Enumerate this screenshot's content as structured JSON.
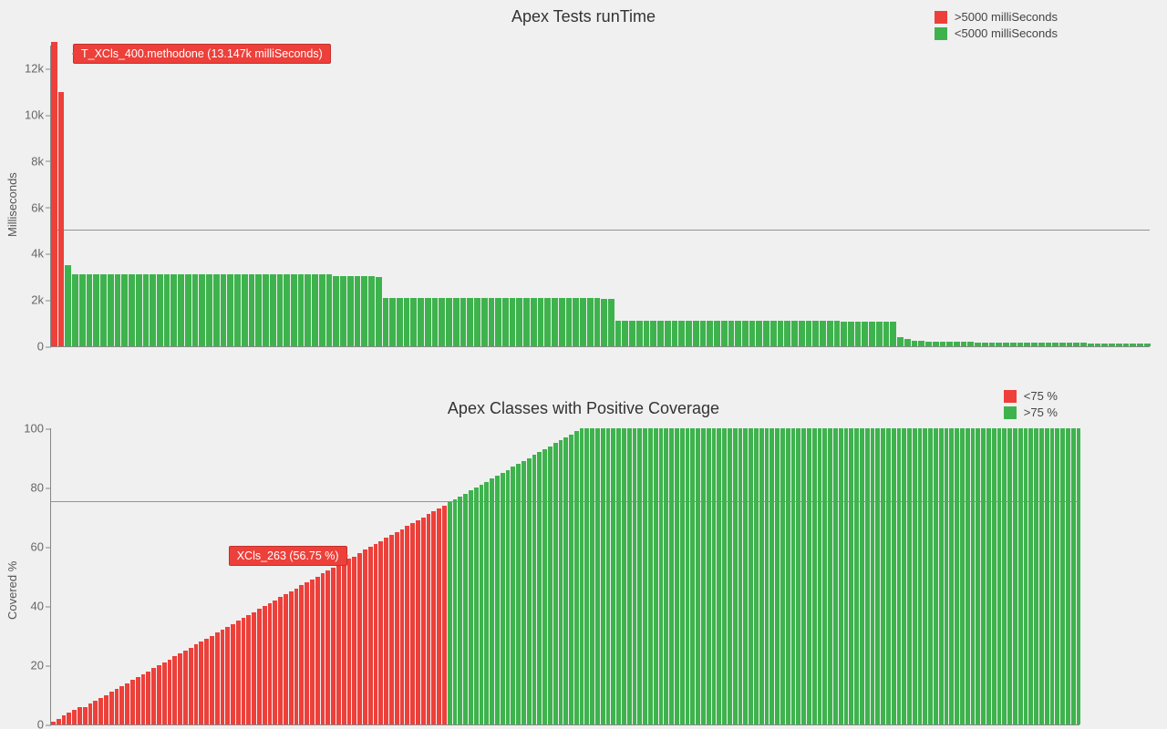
{
  "charts": {
    "runtime": {
      "title": "Apex Tests runTime",
      "ylabel": "Milliseconds",
      "legend_over": ">5000 milliSeconds",
      "legend_under": "<5000 milliSeconds",
      "callout": "T_XCls_400.methodone (13.147k milliSeconds)"
    },
    "coverage": {
      "title": "Apex Classes with Positive Coverage",
      "ylabel": "Covered %",
      "legend_under": "<75 %",
      "legend_over": ">75 %",
      "callout": "XCls_263 (56.75 %)"
    }
  },
  "chart_data": [
    {
      "type": "bar",
      "title": "Apex Tests runTime",
      "ylabel": "Milliseconds",
      "ylim": [
        0,
        13000
      ],
      "yticks": [
        0,
        2000,
        4000,
        6000,
        8000,
        10000,
        12000
      ],
      "ytick_labels": [
        "0",
        "2k",
        "4k",
        "6k",
        "8k",
        "10k",
        "12k"
      ],
      "threshold": 5000,
      "legend": [
        {
          "name": ">5000 milliSeconds",
          "color": "#ED403A"
        },
        {
          "name": "<5000 milliSeconds",
          "color": "#3EB34D"
        }
      ],
      "annotation": {
        "label": "T_XCls_400.methodone",
        "value": 13147,
        "value_display": "13.147k milliSeconds"
      },
      "values": [
        13147,
        11000,
        3500,
        3100,
        3100,
        3100,
        3100,
        3100,
        3100,
        3100,
        3100,
        3100,
        3100,
        3100,
        3100,
        3100,
        3100,
        3100,
        3100,
        3100,
        3100,
        3100,
        3100,
        3100,
        3100,
        3100,
        3100,
        3100,
        3100,
        3100,
        3100,
        3100,
        3100,
        3100,
        3100,
        3100,
        3100,
        3100,
        3100,
        3100,
        3050,
        3050,
        3050,
        3050,
        3050,
        3050,
        3000,
        2100,
        2100,
        2100,
        2100,
        2100,
        2100,
        2100,
        2100,
        2100,
        2100,
        2100,
        2100,
        2100,
        2100,
        2100,
        2100,
        2100,
        2100,
        2100,
        2100,
        2100,
        2100,
        2100,
        2100,
        2100,
        2100,
        2100,
        2100,
        2100,
        2100,
        2100,
        2050,
        2050,
        1100,
        1100,
        1100,
        1100,
        1100,
        1100,
        1100,
        1100,
        1100,
        1100,
        1100,
        1100,
        1100,
        1100,
        1100,
        1100,
        1100,
        1100,
        1100,
        1100,
        1100,
        1100,
        1100,
        1100,
        1100,
        1100,
        1100,
        1100,
        1100,
        1100,
        1100,
        1100,
        1050,
        1050,
        1050,
        1050,
        1050,
        1050,
        1050,
        1050,
        400,
        300,
        250,
        250,
        200,
        200,
        200,
        200,
        180,
        180,
        180,
        170,
        170,
        160,
        160,
        160,
        150,
        150,
        150,
        150,
        150,
        150,
        140,
        140,
        140,
        140,
        140,
        130,
        130,
        130,
        130,
        130,
        120,
        120,
        120,
        120
      ]
    },
    {
      "type": "bar",
      "title": "Apex Classes with Positive Coverage",
      "ylabel": "Covered %",
      "ylim": [
        0,
        100
      ],
      "yticks": [
        0,
        20,
        40,
        60,
        80,
        100
      ],
      "ytick_labels": [
        "0",
        "20",
        "40",
        "60",
        "80",
        "100"
      ],
      "threshold": 75,
      "legend": [
        {
          "name": "<75 %",
          "color": "#ED403A"
        },
        {
          "name": ">75 %",
          "color": "#3EB34D"
        }
      ],
      "annotation": {
        "label": "XCls_263",
        "value": 56.75,
        "value_display": "56.75 %"
      },
      "values": [
        1,
        2,
        3,
        4,
        5,
        6,
        6,
        7,
        8,
        9,
        10,
        11,
        12,
        13,
        14,
        15,
        16,
        17,
        18,
        19,
        20,
        21,
        22,
        23,
        24,
        25,
        26,
        27,
        28,
        29,
        30,
        31,
        32,
        33,
        34,
        35,
        36,
        37,
        38,
        39,
        40,
        41,
        42,
        43,
        44,
        45,
        46,
        47,
        48,
        49,
        50,
        51,
        52,
        53,
        54,
        55,
        56,
        56.75,
        58,
        59,
        60,
        61,
        62,
        63,
        64,
        65,
        66,
        67,
        68,
        69,
        70,
        71,
        72,
        73,
        74,
        75,
        76,
        77,
        78,
        79,
        80,
        81,
        82,
        83,
        84,
        85,
        86,
        87,
        88,
        89,
        90,
        91,
        92,
        93,
        94,
        95,
        96,
        97,
        98,
        99,
        100,
        100,
        100,
        100,
        100,
        100,
        100,
        100,
        100,
        100,
        100,
        100,
        100,
        100,
        100,
        100,
        100,
        100,
        100,
        100,
        100,
        100,
        100,
        100,
        100,
        100,
        100,
        100,
        100,
        100,
        100,
        100,
        100,
        100,
        100,
        100,
        100,
        100,
        100,
        100,
        100,
        100,
        100,
        100,
        100,
        100,
        100,
        100,
        100,
        100,
        100,
        100,
        100,
        100,
        100,
        100,
        100,
        100,
        100,
        100,
        100,
        100,
        100,
        100,
        100,
        100,
        100,
        100,
        100,
        100,
        100,
        100,
        100,
        100,
        100,
        100,
        100,
        100,
        100,
        100,
        100,
        100,
        100,
        100,
        100,
        100,
        100,
        100,
        100,
        100,
        100,
        100,
        100,
        100,
        100
      ]
    }
  ]
}
